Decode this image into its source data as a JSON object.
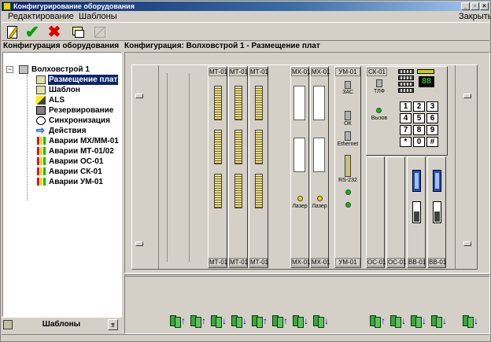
{
  "window": {
    "title": "Конфигурирование оборудования",
    "controls": {
      "minimize": "_",
      "restore": "▫",
      "close": "×"
    }
  },
  "menu": {
    "edit": "Редактирование",
    "templates": "Шаблоны",
    "close": "Закрыть"
  },
  "toolbar": {
    "new": "new-icon",
    "apply": "✔",
    "cancel": "✖",
    "docs": "docs-icon",
    "disabled": "disabled-icon"
  },
  "left_panel": {
    "header": "Конфигурация оборудования",
    "expander": "−",
    "root": "Волховстрой 1",
    "items": [
      {
        "label": "Размещение плат",
        "icon": "board-placement-icon",
        "selected": true
      },
      {
        "label": "Шаблон",
        "icon": "template-icon"
      },
      {
        "label": "ALS",
        "icon": "als-icon"
      },
      {
        "label": "Резервирование",
        "icon": "reserve-icon"
      },
      {
        "label": "Синхронизация",
        "icon": "sync-icon"
      },
      {
        "label": "Действия",
        "icon": "arrow-right-icon",
        "glyph": "⇨"
      },
      {
        "label": "Аварии МХ/ММ-01",
        "icon": "alarm-icon"
      },
      {
        "label": "Аварии МТ-01/02",
        "icon": "alarm-icon"
      },
      {
        "label": "Аварии ОС-01",
        "icon": "alarm-icon"
      },
      {
        "label": "Аварии СК-01",
        "icon": "alarm-icon"
      },
      {
        "label": "Аварии УМ-01",
        "icon": "alarm-icon"
      }
    ],
    "footer_label": "Шаблоны",
    "footer_button": "⌆"
  },
  "right_panel": {
    "header": "Конфигурация: Волховстрой 1 - Размещение плат"
  },
  "cards": {
    "mt": [
      "МТ-01",
      "МТ-01",
      "МТ-01"
    ],
    "mx": [
      "МХ-01",
      "МХ-01"
    ],
    "mx_led_label": "Лазер",
    "um": "УМ-01",
    "um_labels": {
      "sas": "ЗАС",
      "ok": "ОК",
      "ethernet": "Ethernet",
      "rs": "RS-232"
    },
    "sk": "СК-01",
    "sk_labels": {
      "tlf": "ТЛФ",
      "call": "Вызов",
      "display": "88"
    },
    "keypad": [
      "1",
      "2",
      "3",
      "4",
      "5",
      "6",
      "7",
      "8",
      "9",
      "*",
      "0",
      "#"
    ],
    "bottom": [
      "ОС-01",
      "ОС-01",
      "ВВ-01",
      "ВВ-01"
    ]
  },
  "bottom_icons": [
    {
      "icon": "board-up-icon",
      "arrow": "↑"
    },
    {
      "icon": "board-up-icon",
      "arrow": "↑"
    },
    {
      "icon": "board-down-icon",
      "arrow": "↓"
    },
    {
      "icon": "board-down-icon",
      "arrow": "↓"
    },
    {
      "icon": "board-up-icon",
      "arrow": "↑"
    },
    {
      "icon": "board-up-icon",
      "arrow": "↑"
    },
    {
      "icon": "board-down-icon",
      "arrow": "↓"
    },
    {
      "icon": "board-down-icon",
      "arrow": "↓"
    },
    {
      "icon": "board-up-icon",
      "arrow": "↑"
    },
    {
      "icon": "board-down-icon",
      "arrow": "↓"
    },
    {
      "icon": "board-down-icon",
      "arrow": "↓"
    },
    {
      "icon": "board-down-icon",
      "arrow": "↓"
    },
    {
      "icon": "board-down-icon",
      "arrow": "↓"
    }
  ]
}
